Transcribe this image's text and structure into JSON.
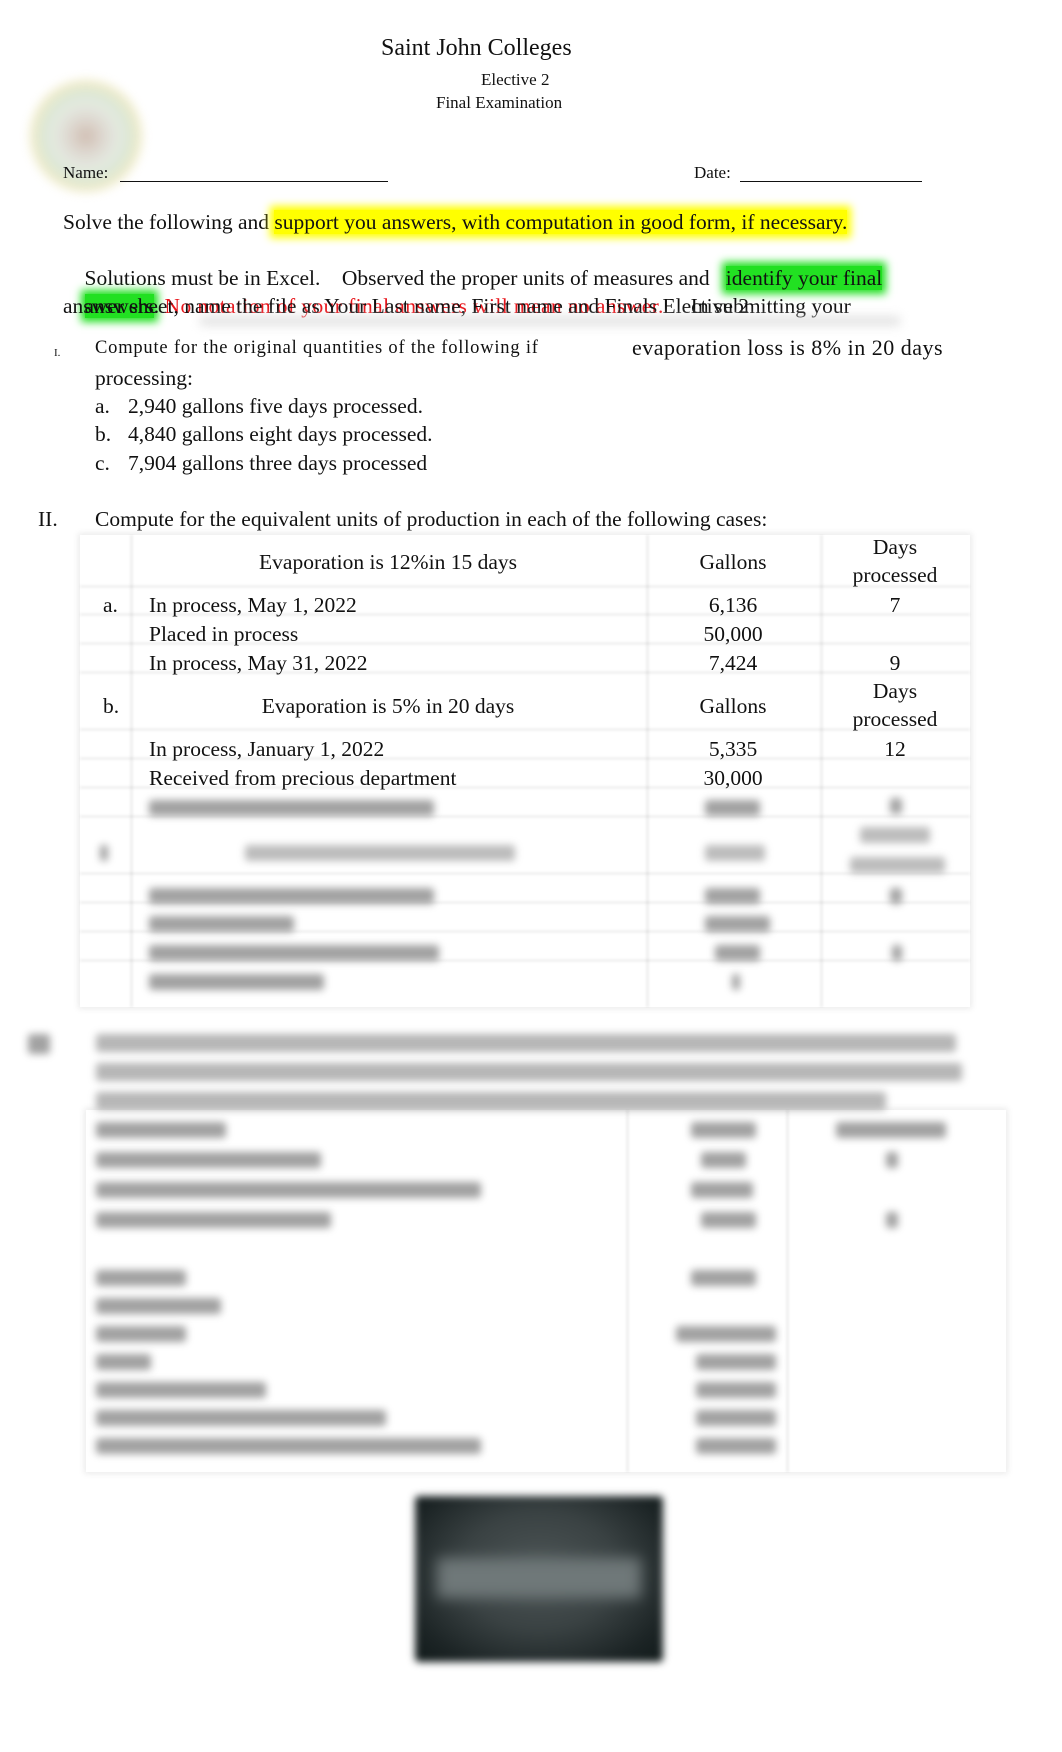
{
  "header": {
    "school": "Saint John Colleges",
    "course": "Elective 2",
    "exam": "Final Examination",
    "logo_icon": "school-seal-logo"
  },
  "form": {
    "name_label": "Name:",
    "name_value": "",
    "date_label": "Date:",
    "date_value": ""
  },
  "instructions": {
    "line1_plain": "Solve the following and ",
    "line1_yellow": "support you answers, with computation in good form, if necessary.",
    "line2_plain": "Solutions must be in Excel.    Observed the proper units of measures and   ",
    "line2_green": "identify your final",
    "line3_green": "answers",
    "line3_dot": ". ",
    "line3_red": "No notation of your final answers will mean no answer.",
    "line3_plain": "     In submitting your",
    "line4_plain": "answer sheet, name the file as Your Last name, First name and Finals Elective 2",
    "colors": {
      "yellow_highlight": "#ffff00",
      "green_highlight": "#22e022",
      "red_text": "#e8141a"
    }
  },
  "section1": {
    "number": "I.",
    "text_part1": "Compute for the original quantities of the following if",
    "text_part2": "evaporation loss is 8% in 20 days",
    "text_part3": "processing:",
    "items": [
      {
        "label": "a.",
        "text": "2,940 gallons five days processed."
      },
      {
        "label": "b.",
        "text": "4,840 gallons eight days processed."
      },
      {
        "label": "c.",
        "text": "7,904 gallons three days processed"
      }
    ]
  },
  "section2": {
    "number": "II.",
    "text": "Compute for the equivalent units of production in each of the following cases:",
    "cases": [
      {
        "label": "",
        "title": "Evaporation is 12%in 15 days",
        "col_gallons": "Gallons",
        "col_days_line1": "Days",
        "col_days_line2": "processed",
        "case_label": "a.",
        "rows": [
          {
            "desc": "In process, May 1, 2022",
            "gallons": "6,136",
            "days": "7"
          },
          {
            "desc": "Placed in process",
            "gallons": "50,000",
            "days": ""
          },
          {
            "desc": "In process, May 31, 2022",
            "gallons": "7,424",
            "days": "9"
          }
        ]
      },
      {
        "label": "b.",
        "title": "Evaporation is 5% in 20 days",
        "col_gallons": "Gallons",
        "col_days_line1": "Days",
        "col_days_line2": "processed",
        "rows": [
          {
            "desc": "In process, January 1, 2022",
            "gallons": "5,335",
            "days": "12"
          },
          {
            "desc": "Received from precious department",
            "gallons": "30,000",
            "days": ""
          }
        ]
      }
    ],
    "blurred_note": "remaining rows obscured"
  },
  "section3": {
    "blurred_note": "section obscured"
  },
  "preview_image": {
    "icon": "blurred-preview-image"
  }
}
